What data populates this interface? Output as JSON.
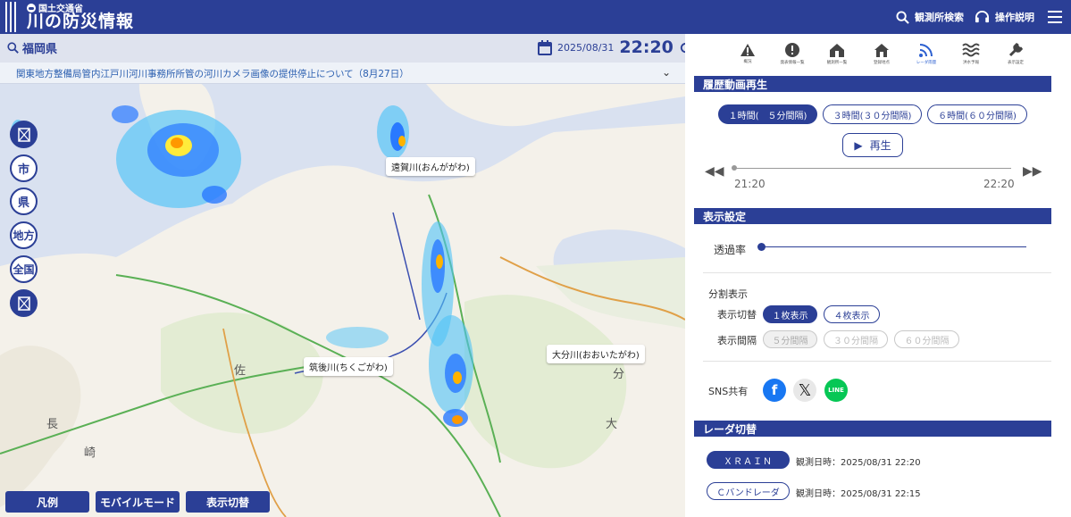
{
  "header": {
    "ministry": "国土交通省",
    "title": "川の防災情報",
    "search_label": "観測所検索",
    "help_label": "操作説明"
  },
  "map": {
    "prefecture": "福岡県",
    "date": "2025/08/31",
    "time": "22:20",
    "notice": "関東地方整備局管内江戸川河川事務所所管の河川カメラ画像の提供停止について（8月27日）",
    "rivers": [
      "遠賀川(おんががわ)",
      "筑後川(ちくごがわ)",
      "大分川(おおいたがわ)"
    ],
    "side_buttons": [
      "市",
      "県",
      "地方",
      "全国"
    ],
    "bottom_buttons": [
      "凡例",
      "モバイルモード",
      "表示切替"
    ],
    "place_kanji": [
      "佐",
      "長",
      "崎",
      "分",
      "大"
    ]
  },
  "panel": {
    "tools": [
      "概況",
      "発表情報一覧",
      "観測所一覧",
      "登録地点",
      "レーダ雨量",
      "洪水予報",
      "表示設定"
    ],
    "history": {
      "title": "履歴動画再生",
      "intervals": [
        "１時間(　５分間隔)",
        "３時間(３０分間隔)",
        "６時間(６０分間隔)"
      ],
      "play_label": "再生",
      "start": "21:20",
      "end": "22:20"
    },
    "display": {
      "title": "表示設定",
      "opacity_label": "透過率",
      "split_label": "分割表示",
      "switch_label": "表示切替",
      "switch_options": [
        "１枚表示",
        "４枚表示"
      ],
      "interval_label": "表示間隔",
      "interval_options": [
        "５分間隔",
        "３０分間隔",
        "６０分間隔"
      ],
      "sns_label": "SNS共有"
    },
    "radar": {
      "title": "レーダ切替",
      "items": [
        {
          "name": "ＸＲＡＩＮ",
          "time": "観測日時：2025/08/31 22:20"
        },
        {
          "name": "Ｃバンドレーダ",
          "time": "観測日時：2025/08/31 22:15"
        }
      ]
    }
  },
  "colors": {
    "brand": "#2b3f96"
  }
}
